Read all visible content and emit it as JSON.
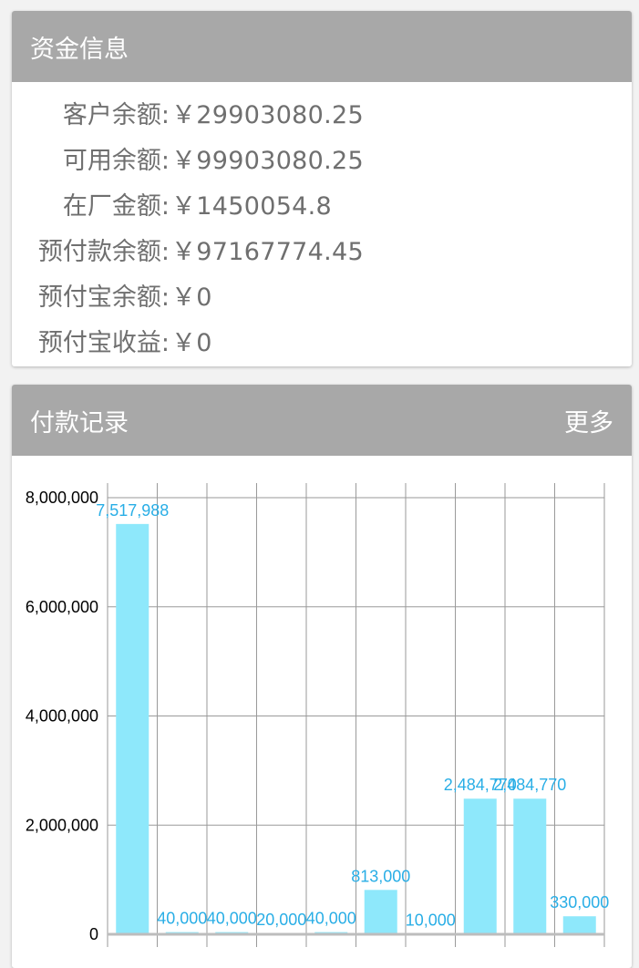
{
  "funds": {
    "title": "资金信息",
    "rows": [
      {
        "label": "客户余额:",
        "value": "￥29903080.25"
      },
      {
        "label": "可用余额:",
        "value": "￥99903080.25"
      },
      {
        "label": "在厂金额:",
        "value": "￥1450054.8"
      },
      {
        "label": "预付款余额:",
        "value": "￥97167774.45"
      },
      {
        "label": "预付宝余额:",
        "value": "￥0"
      },
      {
        "label": "预付宝收益:",
        "value": "￥0"
      }
    ]
  },
  "payments": {
    "title": "付款记录",
    "more_label": "更多"
  },
  "colors": {
    "header_bg": "#a8a8a8",
    "bar_fill": "#8ee8fb",
    "bar_label": "#29aee6",
    "text_gray": "#6f6f6f"
  },
  "chart_data": {
    "type": "bar",
    "values": [
      7517988,
      40000,
      40000,
      20000,
      40000,
      813000,
      10000,
      2484770,
      2484770,
      330000
    ],
    "data_labels": [
      "7,517,988",
      "40,000",
      "40,000",
      "20,000",
      "40,000",
      "813,000",
      "10,000",
      "2,484,770",
      "2,484,770",
      "330,000"
    ],
    "y_ticks": [
      0,
      2000000,
      4000000,
      6000000,
      8000000
    ],
    "y_tick_labels": [
      "0",
      "2,000,000",
      "4,000,000",
      "6,000,000",
      "8,000,000"
    ],
    "ylim": [
      0,
      8000000
    ],
    "grid": true
  }
}
